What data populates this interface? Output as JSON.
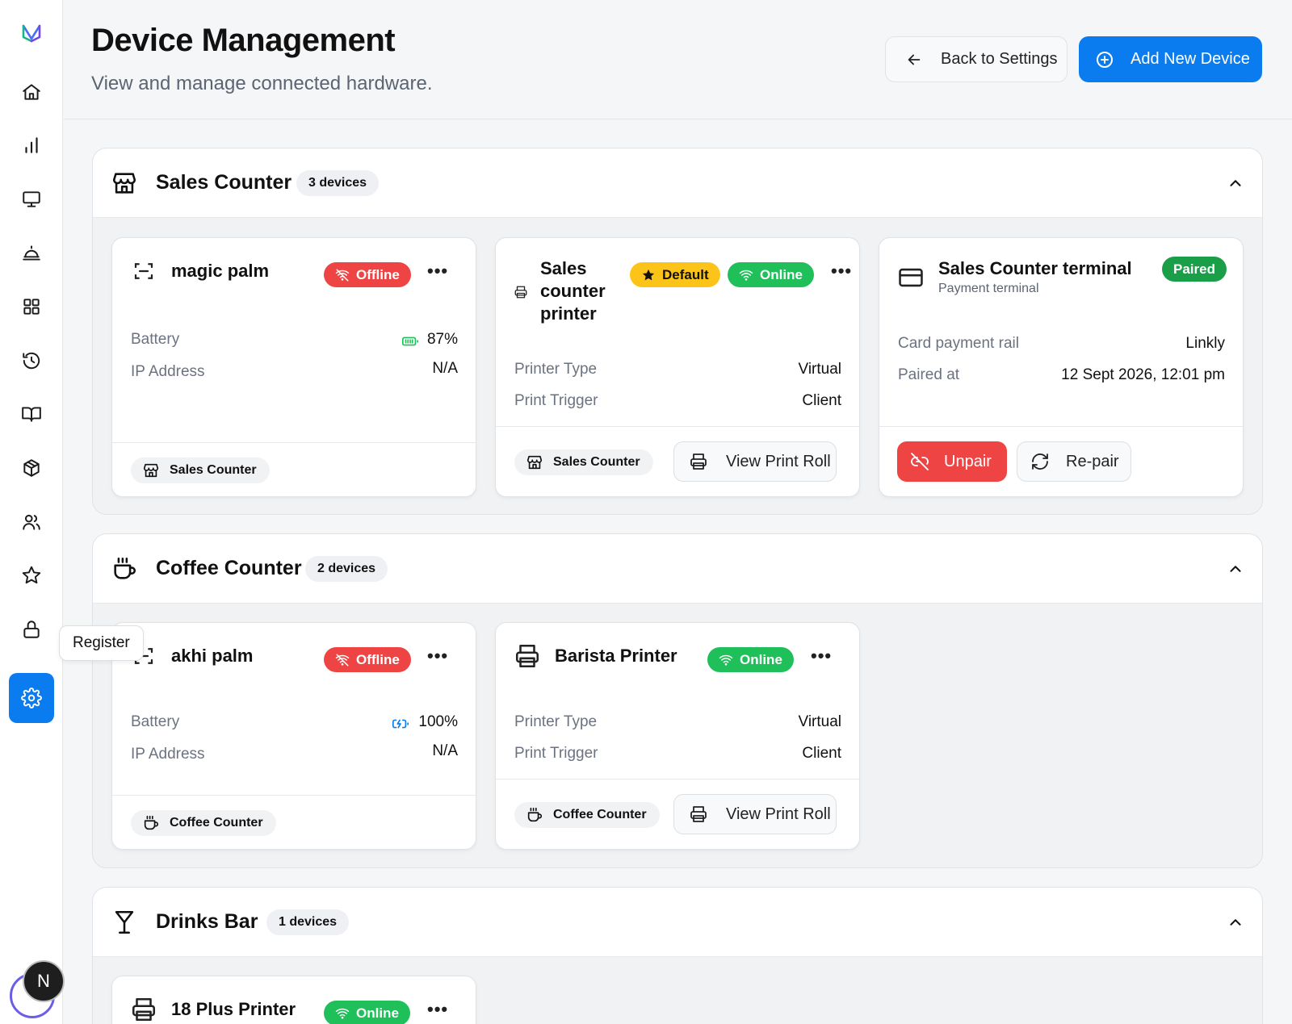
{
  "header": {
    "title": "Device Management",
    "subtitle": "View and manage connected hardware.",
    "back_label": "Back to Settings",
    "add_label": "Add New Device"
  },
  "sidebar": {
    "tooltip": "Register",
    "avatar_initial": "N",
    "items": [
      "home-icon",
      "chart-icon",
      "monitor-icon",
      "bell-icon",
      "grid-icon",
      "history-icon",
      "book-icon",
      "box-icon",
      "users-icon",
      "star-icon",
      "lock-icon",
      "settings-icon"
    ]
  },
  "colors": {
    "accent": "#0b7cf0",
    "offline": "#ef4444",
    "online": "#1fbf5a",
    "default": "#fcc419",
    "paired": "#1a9e48"
  },
  "sections": [
    {
      "name": "Sales Counter",
      "count": "3 devices",
      "devices": [
        {
          "name": "magic palm",
          "status": "Offline",
          "rows": [
            {
              "label": "Battery",
              "value": "87%"
            },
            {
              "label": "IP Address",
              "value": "N/A"
            }
          ],
          "location": "Sales Counter"
        },
        {
          "name": "Sales counter printer",
          "default_badge": "Default",
          "status": "Online",
          "rows": [
            {
              "label": "Printer Type",
              "value": "Virtual"
            },
            {
              "label": "Print Trigger",
              "value": "Client"
            }
          ],
          "location": "Sales Counter",
          "action": "View Print Roll"
        },
        {
          "name": "Sales Counter terminal",
          "subtitle": "Payment terminal",
          "status": "Paired",
          "rows": [
            {
              "label": "Card payment rail",
              "value": "Linkly"
            },
            {
              "label": "Paired at",
              "value": "12 Sept 2026, 12:01 pm"
            }
          ],
          "unpair_label": "Unpair",
          "repair_label": "Re-pair"
        }
      ]
    },
    {
      "name": "Coffee Counter",
      "count": "2 devices",
      "devices": [
        {
          "name": "akhi palm",
          "status": "Offline",
          "rows": [
            {
              "label": "Battery",
              "value": "100%"
            },
            {
              "label": "IP Address",
              "value": "N/A"
            }
          ],
          "location": "Coffee Counter"
        },
        {
          "name": "Barista Printer",
          "status": "Online",
          "rows": [
            {
              "label": "Printer Type",
              "value": "Virtual"
            },
            {
              "label": "Print Trigger",
              "value": "Client"
            }
          ],
          "location": "Coffee Counter",
          "action": "View Print Roll"
        }
      ]
    },
    {
      "name": "Drinks Bar",
      "count": "1 devices",
      "devices": [
        {
          "name": "18 Plus Printer",
          "status": "Online"
        }
      ]
    }
  ]
}
